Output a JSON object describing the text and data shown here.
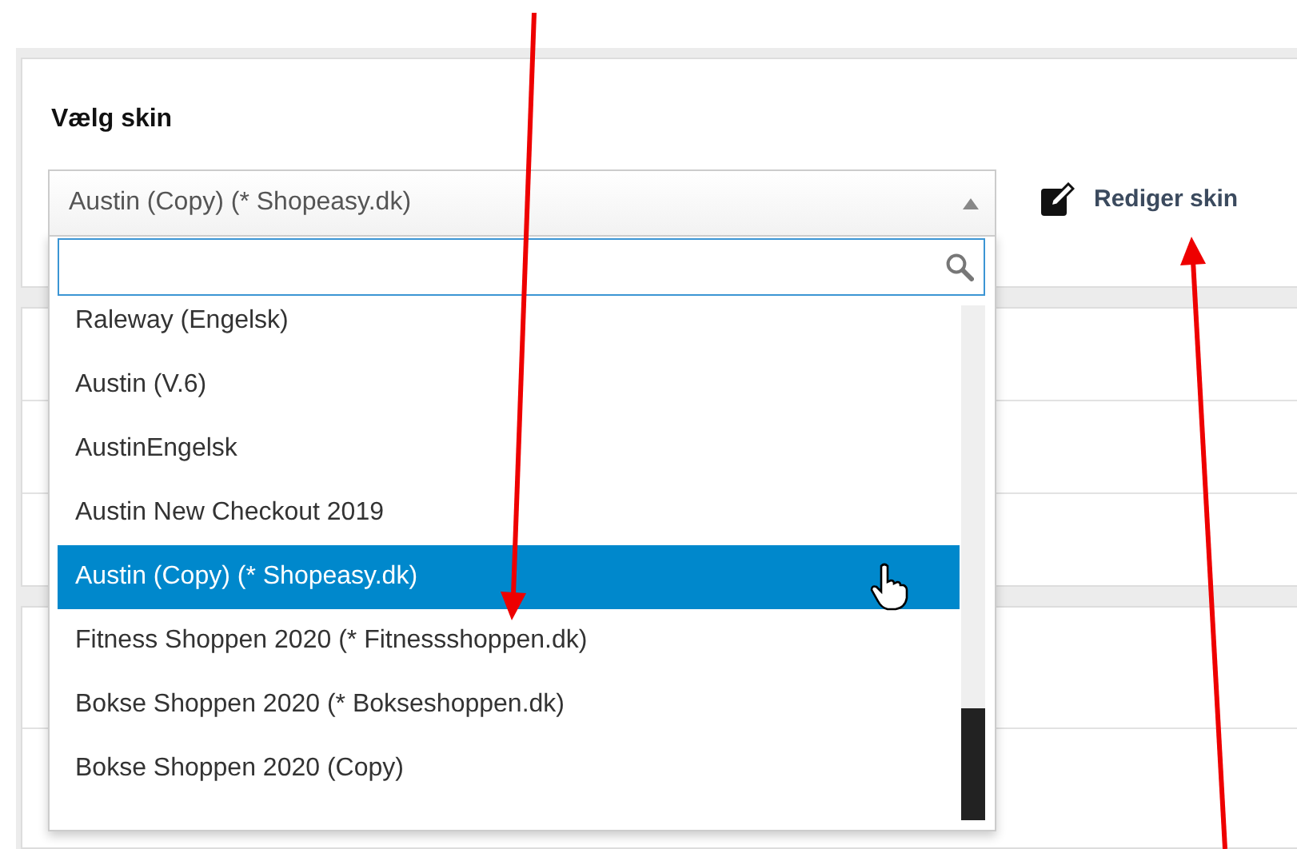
{
  "heading": "Vælg skin",
  "select": {
    "value": "Austin (Copy) (* Shopeasy.dk)",
    "expanded": true
  },
  "edit_link": {
    "label": "Rediger skin"
  },
  "options": [
    {
      "label": "Raleway (Engelsk)",
      "selected": false
    },
    {
      "label": "Austin (V.6)",
      "selected": false
    },
    {
      "label": "AustinEngelsk",
      "selected": false
    },
    {
      "label": "Austin New Checkout 2019",
      "selected": false
    },
    {
      "label": "Austin (Copy) (* Shopeasy.dk)",
      "selected": true
    },
    {
      "label": "Fitness Shoppen 2020 (* Fitnessshoppen.dk)",
      "selected": false
    },
    {
      "label": "Bokse Shoppen 2020 (* Bokseshoppen.dk)",
      "selected": false
    },
    {
      "label": "Bokse Shoppen 2020 (Copy)",
      "selected": false
    }
  ]
}
